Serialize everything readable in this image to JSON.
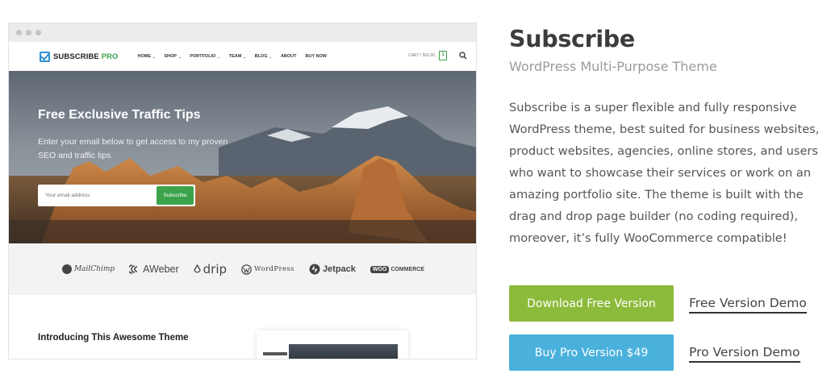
{
  "preview": {
    "logo": {
      "main": "SUBSCRIBE ",
      "accent": "PRO"
    },
    "nav": [
      "HOME",
      "SHOP",
      "PORTFOLIO",
      "TEAM",
      "BLOG",
      "ABOUT",
      "BUY NOW"
    ],
    "nav_caret": "⌄",
    "cart": {
      "label": "CART / $10.00",
      "count": "1"
    },
    "hero": {
      "title": "Free Exclusive Traffic Tips",
      "description": "Enter your email below to get access to my proven SEO and traffic tips.",
      "email_placeholder": "Your email address",
      "button_label": "Subscribe"
    },
    "partners": [
      "MailChimp",
      "AWeber",
      "drip",
      "WordPress",
      "Jetpack",
      "COMMERCE"
    ],
    "woo_badge": "WOO",
    "intro_title": "Introducing This Awesome Theme"
  },
  "info": {
    "title": "Subscribe",
    "subtitle": "WordPress Multi-Purpose Theme",
    "description": "Subscribe is a super flexible and fully responsive WordPress theme, best suited for business websites, product websites, agencies, online stores, and users who want to showcase their services or work on an amazing portfolio site. The theme is built with the drag and drop page builder (no coding required), moreover, it’s fully WooCommerce compatible!",
    "download_button": "Download Free Version",
    "free_demo_link": "Free Version Demo",
    "buy_button": "Buy Pro Version $49",
    "pro_demo_link": "Pro Version Demo"
  },
  "colors": {
    "download_button": "#8cba3a",
    "buy_button": "#49b1dc",
    "subscribe_green": "#3aa34b",
    "logo_blue": "#2f8fd1"
  },
  "icons": [
    "check-logo-icon",
    "cart-icon",
    "search-icon",
    "mailchimp-icon",
    "aweber-icon",
    "drip-icon",
    "wordpress-icon",
    "jetpack-icon"
  ]
}
